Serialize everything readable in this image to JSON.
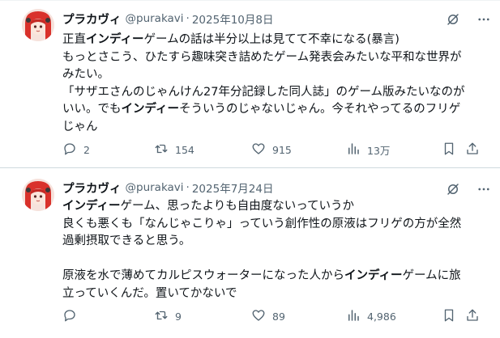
{
  "tweets": [
    {
      "display_name": "プラカヴィ",
      "handle": "@purakavi",
      "separator": "·",
      "date": "2025年10月8日",
      "lines": [
        [
          {
            "t": "正直"
          },
          {
            "t": "インディー",
            "b": true
          },
          {
            "t": "ゲームの話は半分以上は見てて不幸になる(暴言)"
          }
        ],
        [
          {
            "t": "もっとさこう、ひたすら趣味突き詰めたゲーム発表会みたいな平和な世界が"
          }
        ],
        [
          {
            "t": "みたい。"
          }
        ],
        [
          {
            "t": "「サザエさんのじゃんけん27年分記録した同人誌」のゲーム版みたいなのが"
          }
        ],
        [
          {
            "t": "いい。でも"
          },
          {
            "t": "インディー",
            "b": true
          },
          {
            "t": "そういうのじゃないじゃん。今それやってるのフリゲ"
          }
        ],
        [
          {
            "t": "じゃん"
          }
        ]
      ],
      "stats": {
        "replies": "2",
        "retweets": "154",
        "likes": "915",
        "views": "13万"
      }
    },
    {
      "display_name": "プラカヴィ",
      "handle": "@purakavi",
      "separator": "·",
      "date": "2025年7月24日",
      "lines": [
        [
          {
            "t": "インディー",
            "b": true
          },
          {
            "t": "ゲーム、思ったよりも自由度ないっていうか"
          }
        ],
        [
          {
            "t": "良くも悪くも「なんじゃこりゃ」っていう創作性の原液はフリゲの方が全然"
          }
        ],
        [
          {
            "t": "過剰摂取できると思う。"
          }
        ],
        [],
        [
          {
            "t": "原液を水で薄めてカルピスウォーターになった人から"
          },
          {
            "t": "インディー",
            "b": true
          },
          {
            "t": "ゲームに旅"
          }
        ],
        [
          {
            "t": "立っていくんだ。置いてかないで"
          }
        ]
      ],
      "stats": {
        "replies": "",
        "retweets": "9",
        "likes": "89",
        "views": "4,986"
      }
    }
  ],
  "icons": {
    "top": [
      "grok-icon",
      "more-icon"
    ],
    "actions": [
      "reply-icon",
      "retweet-icon",
      "like-icon",
      "views-icon",
      "bookmark-icon",
      "share-icon"
    ]
  },
  "colors": {
    "text": "#0f1419",
    "muted": "#536471",
    "border": "#cfd9de",
    "avatar_hair": "#d9312b"
  }
}
